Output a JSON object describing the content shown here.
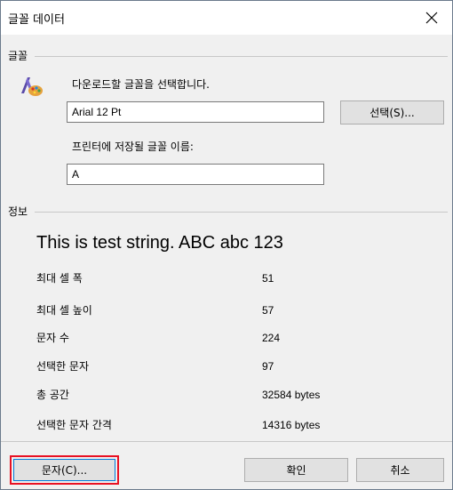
{
  "window": {
    "title": "글꼴 데이터",
    "close_glyph": "✕"
  },
  "font_group": {
    "label": "글꼴",
    "download_prompt": "다운로드할 글꼴을 선택합니다.",
    "font_value": "Arial 12 Pt",
    "select_button": "선택(S)...",
    "printer_name_label": "프린터에 저장될 글꼴 이름:",
    "printer_name_value": "A"
  },
  "info_group": {
    "label": "정보",
    "sample_text": "This is test string. ABC abc 123",
    "rows": [
      {
        "label": "최대 셀 폭",
        "value": "51"
      },
      {
        "label": "최대 셀 높이",
        "value": "57"
      },
      {
        "label": "문자 수",
        "value": "224"
      },
      {
        "label": "선택한 문자",
        "value": "97"
      },
      {
        "label": "총 공간",
        "value": "32584 bytes"
      },
      {
        "label": "선택한 문자 간격",
        "value": "14316 bytes"
      }
    ]
  },
  "footer": {
    "char_button": "문자(C)...",
    "ok_button": "확인",
    "cancel_button": "취소"
  }
}
